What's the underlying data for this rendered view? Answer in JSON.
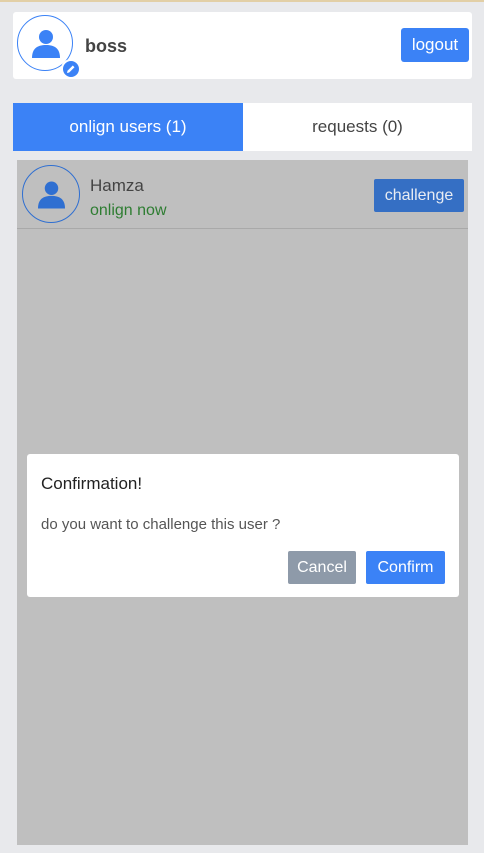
{
  "header": {
    "username": "boss",
    "logout_label": "logout"
  },
  "tabs": [
    {
      "label": "onlign users (1)",
      "active": true
    },
    {
      "label": "requests (0)",
      "active": false
    }
  ],
  "users": [
    {
      "name": "Hamza",
      "status": "onlign now",
      "action_label": "challenge"
    }
  ],
  "dialog": {
    "title": "Confirmation!",
    "message": "do you want to challenge this user ?",
    "cancel_label": "Cancel",
    "confirm_label": "Confirm"
  },
  "colors": {
    "accent": "#3b82f6",
    "status_online": "#2e7d32"
  }
}
